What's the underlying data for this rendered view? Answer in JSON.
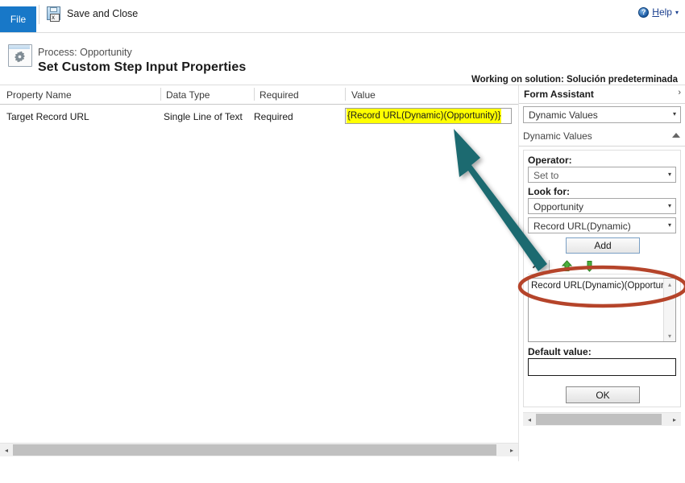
{
  "ribbon": {
    "file_tab": "File",
    "save_and_close": "Save and Close",
    "save_icon": "save-disk-icon",
    "help_label_accel": "H",
    "help_label_rest": "elp",
    "help_icon": "help-orb-icon",
    "help_caret": "▾"
  },
  "header": {
    "process_line": "Process: Opportunity",
    "title": "Set Custom Step Input Properties",
    "solution_note": "Working on solution: Solución predeterminada",
    "icon": "process-gear-window-icon"
  },
  "grid": {
    "columns": [
      "Property Name",
      "Data Type",
      "Required",
      "Value"
    ],
    "rows": [
      {
        "property_name": "Target Record URL",
        "data_type": "Single Line of Text",
        "required": "Required",
        "value": "{Record URL(Dynamic)(Opportunity)}",
        "value_highlight_color": "#ffff00"
      }
    ],
    "scrollbar": {
      "left_arrow": "◂",
      "right_arrow": "▸"
    }
  },
  "form_assistant": {
    "title": "Form Assistant",
    "expand_chevron": "›",
    "assistant_type": "Dynamic Values",
    "section_title": "Dynamic Values",
    "section_collapse_icon": "chevron-up-icon",
    "operator_label": "Operator:",
    "operator_value": "Set to",
    "look_for_label": "Look for:",
    "look_for_entity": "Opportunity",
    "look_for_attribute": "Record URL(Dynamic)",
    "add_button": "Add",
    "delete_icon": "delete-x-icon",
    "move_up_icon": "green-arrow-up-icon",
    "move_down_icon": "green-arrow-down-icon",
    "values": [
      "Record URL(Dynamic)(Opportunity)"
    ],
    "default_value_label": "Default value:",
    "default_value": "",
    "default_value_placeholder": "",
    "ok_button": "OK",
    "dropdown_caret": "▾",
    "list_scroll_up": "▴",
    "list_scroll_down": "▾",
    "panel_scroll_left": "◂",
    "panel_scroll_right": "▸"
  },
  "annotations": {
    "arrow_color": "#1f6b70",
    "ellipse_color": "#b5442a",
    "arrow_name": "teal-callout-arrow",
    "ellipse_name": "red-callout-ellipse"
  }
}
